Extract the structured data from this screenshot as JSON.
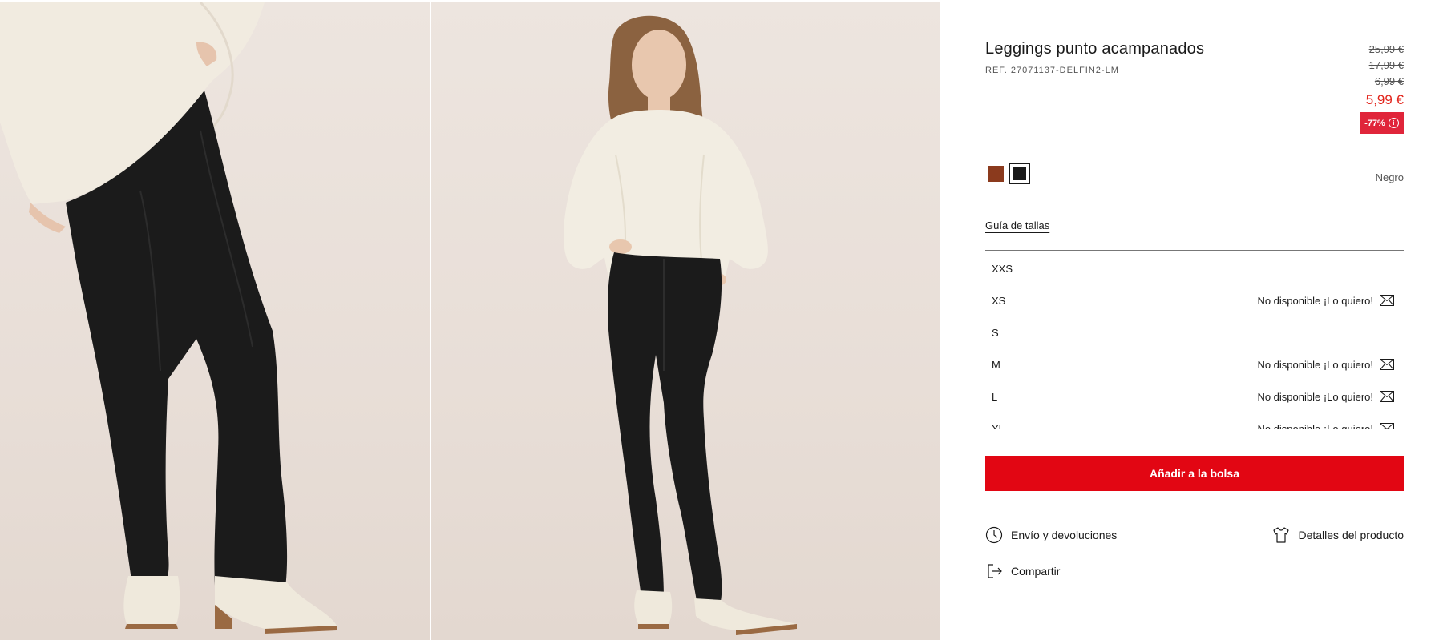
{
  "product": {
    "title": "Leggings punto acampanados",
    "ref": "REF. 27071137-DELFIN2-LM",
    "old_prices": [
      "25,99 €",
      "17,99 €",
      "6,99 €"
    ],
    "current_price": "5,99 €",
    "discount": "-77%",
    "info_icon": "i"
  },
  "colors": {
    "swatches": [
      {
        "name": "brown-swatch",
        "hex": "#8b3a1d"
      },
      {
        "name": "black-swatch",
        "hex": "#1a1a1a"
      }
    ],
    "selected_name": "Negro"
  },
  "size_guide_label": "Guía de tallas",
  "sizes": [
    {
      "label": "XXS",
      "status": ""
    },
    {
      "label": "XS",
      "status": "No disponible ¡Lo quiero!"
    },
    {
      "label": "S",
      "status": ""
    },
    {
      "label": "M",
      "status": "No disponible ¡Lo quiero!"
    },
    {
      "label": "L",
      "status": "No disponible ¡Lo quiero!"
    },
    {
      "label": "XL",
      "status": "No disponible ¡Lo quiero!"
    }
  ],
  "add_to_bag_label": "Añadir a la bolsa",
  "links": {
    "shipping": "Envío y devoluciones",
    "details": "Detalles del producto",
    "share": "Compartir"
  },
  "icons": {
    "shipping": "clock-icon",
    "details": "tshirt-icon",
    "share": "share-icon",
    "notify": "envelope-icon"
  },
  "theme": {
    "accent_red": "#e20613",
    "price_red": "#e2231a",
    "badge_red": "#e0253a"
  }
}
